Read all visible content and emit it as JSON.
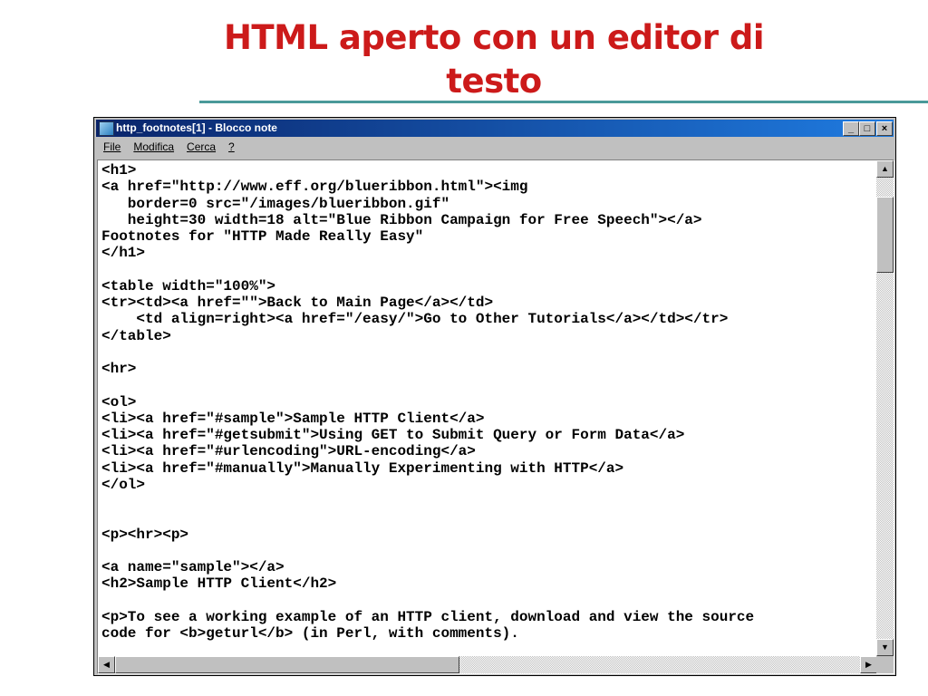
{
  "slide": {
    "title": "HTML aperto con un editor di testo"
  },
  "window": {
    "title": "http_footnotes[1] - Blocco note",
    "minimize": "_",
    "maximize": "□",
    "close": "×"
  },
  "menu": [
    "File",
    "Modifica",
    "Cerca",
    "?"
  ],
  "lines": [
    "<h1>",
    "<a href=\"http://www.eff.org/blueribbon.html\"><img",
    "   border=0 src=\"/images/blueribbon.gif\"",
    "   height=30 width=18 alt=\"Blue Ribbon Campaign for Free Speech\"></a>",
    "Footnotes for \"HTTP Made Really Easy\"",
    "</h1>",
    "",
    "<table width=\"100%\">",
    "<tr><td><a href=\"\">Back to Main Page</a></td>",
    "    <td align=right><a href=\"/easy/\">Go to Other Tutorials</a></td></tr>",
    "</table>",
    "",
    "<hr>",
    "",
    "<ol>",
    "<li><a href=\"#sample\">Sample HTTP Client</a>",
    "<li><a href=\"#getsubmit\">Using GET to Submit Query or Form Data</a>",
    "<li><a href=\"#urlencoding\">URL-encoding</a>",
    "<li><a href=\"#manually\">Manually Experimenting with HTTP</a>",
    "</ol>",
    "",
    "",
    "<p><hr><p>",
    "",
    "<a name=\"sample\"></a>",
    "<h2>Sample HTTP Client</h2>",
    "",
    "<p>To see a working example of an HTTP client, download and view the source",
    "code for <b>geturl</b> (in Perl, with comments)."
  ],
  "scroll": {
    "up": "▲",
    "down": "▼",
    "left": "◀",
    "right": "▶"
  }
}
